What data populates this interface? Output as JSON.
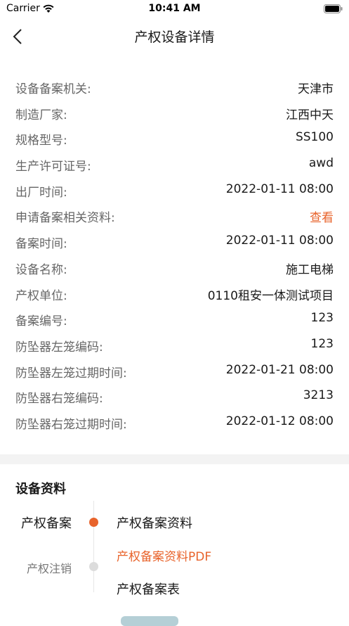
{
  "status_bar": {
    "carrier": "Carrier",
    "time": "10:41 AM"
  },
  "nav": {
    "title": "产权设备详情",
    "back_icon": "chevron-left-icon"
  },
  "details": [
    {
      "label": "设备备案机关:",
      "value": "天津市"
    },
    {
      "label": "制造厂家:",
      "value": "江西中天"
    },
    {
      "label": "规格型号:",
      "value": "SS100"
    },
    {
      "label": "生产许可证号:",
      "value": "awd"
    },
    {
      "label": "出厂时间:",
      "value": "2022-01-11 08:00"
    },
    {
      "label": "申请备案相关资料:",
      "value": "查看"
    },
    {
      "label": "备案时间:",
      "value": "2022-01-11 08:00"
    },
    {
      "label": "设备名称:",
      "value": "施工电梯"
    },
    {
      "label": "产权单位:",
      "value": "0110租安一体测试项目"
    },
    {
      "label": "备案编号:",
      "value": "123"
    },
    {
      "label": "防坠器左笼编码:",
      "value": "123"
    },
    {
      "label": "防坠器左笼过期时间:",
      "value": "2022-01-21 08:00"
    },
    {
      "label": "防坠器右笼编码:",
      "value": "3213"
    },
    {
      "label": "防坠器右笼过期时间:",
      "value": "2022-01-12 08:00"
    }
  ],
  "documents": {
    "title": "设备资料",
    "tabs": [
      {
        "label": "产权备案",
        "active": true
      },
      {
        "label": "产权注销",
        "active": false
      }
    ],
    "items": [
      {
        "label": "产权备案资料"
      },
      {
        "label": "产权备案资料PDF"
      },
      {
        "label": "产权备案表"
      }
    ]
  },
  "colors": {
    "accent": "#e8632b",
    "band": "#f3f3f3"
  }
}
